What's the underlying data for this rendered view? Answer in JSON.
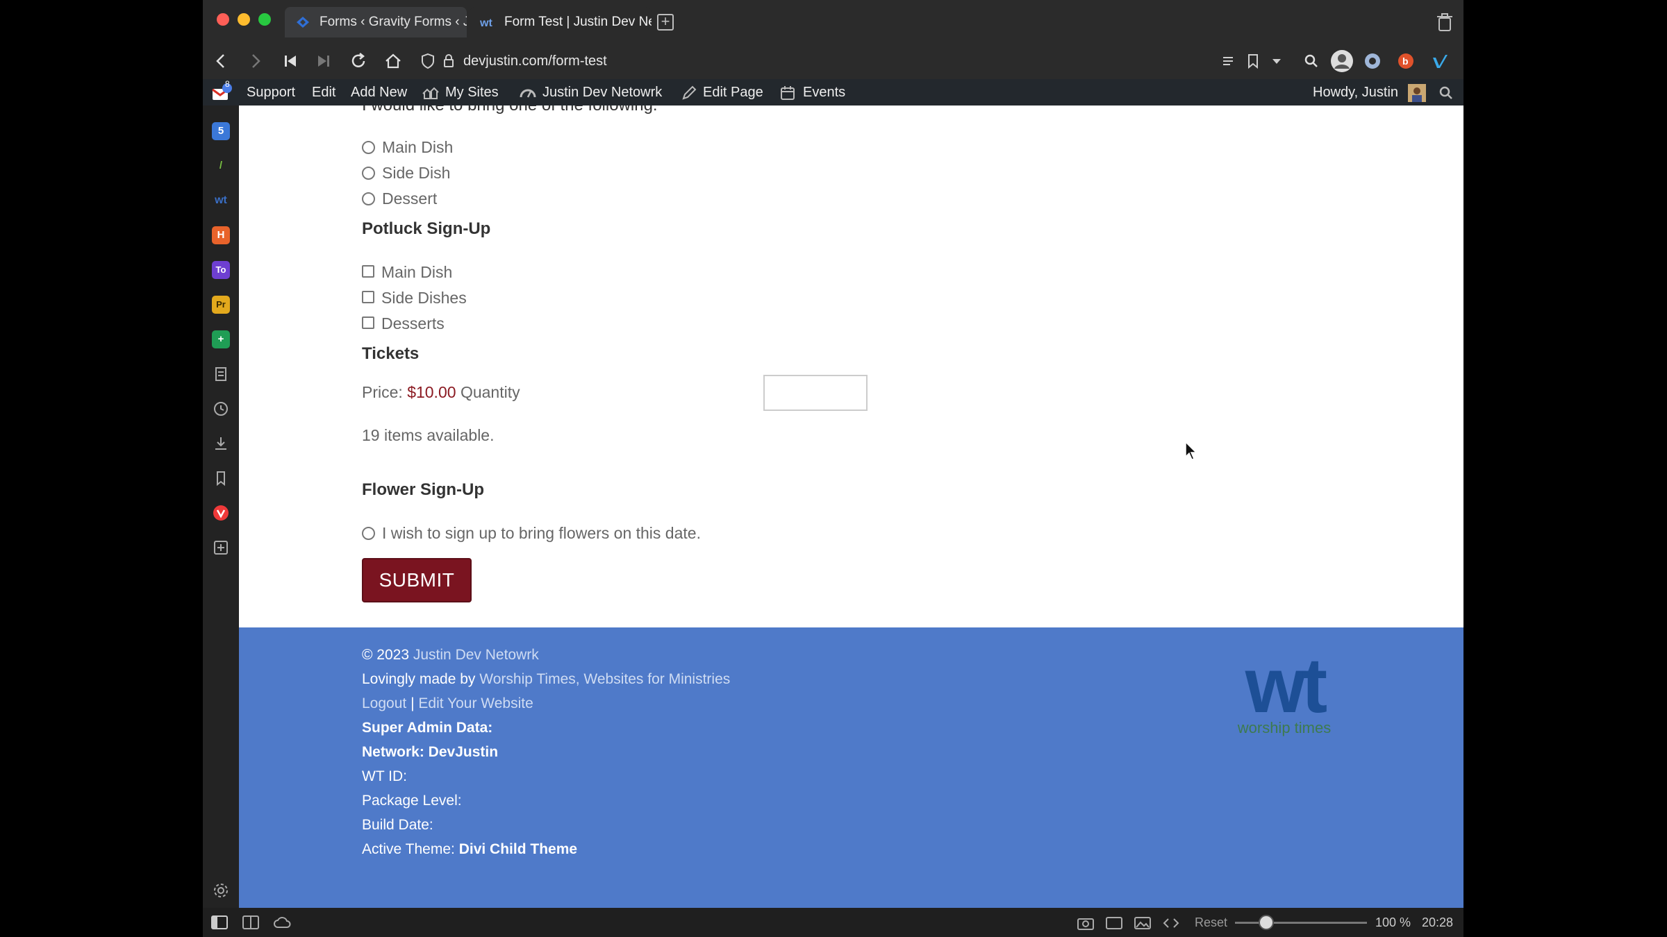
{
  "browser": {
    "tabs": [
      {
        "label": "Forms ‹ Gravity Forms ‹ Justin Dev Netowrk"
      },
      {
        "label": "Form Test | Justin Dev Netowrk"
      }
    ],
    "url": "devjustin.com/form-test"
  },
  "admin_bar": {
    "support": "Support",
    "edit": "Edit",
    "add_new": "Add New",
    "my_sites": "My Sites",
    "site_name": "Justin Dev Netowrk",
    "edit_page": "Edit Page",
    "events": "Events",
    "howdy": "Howdy, Justin",
    "notif_count": "8"
  },
  "form": {
    "bring_heading": "I would like to bring one of the following:",
    "bring_options": [
      "Main Dish",
      "Side Dish",
      "Dessert"
    ],
    "potluck_title": "Potluck Sign-Up",
    "potluck_options": [
      "Main Dish",
      "Side Dishes",
      "Desserts"
    ],
    "tickets_title": "Tickets",
    "price_label": "Price:",
    "price_value": "$10.00",
    "quantity_label": "Quantity",
    "quantity_value": "",
    "available": "19 items available.",
    "flower_title": "Flower Sign-Up",
    "flower_option": "I wish to sign up to bring flowers on this date.",
    "submit_label": "SUBMIT"
  },
  "footer": {
    "copyright": "© 2023",
    "site_link": "Justin Dev Netowrk",
    "made_by": "Lovingly made by",
    "made_by_link": "Worship Times, Websites for Ministries",
    "logout": "Logout",
    "separator": "|",
    "edit_website": "Edit Your Website",
    "super_admin": "Super Admin Data:",
    "network": "Network: DevJustin",
    "wt_id": "WT ID:",
    "package_level": "Package Level:",
    "build_date": "Build Date:",
    "active_theme_label": "Active Theme:",
    "active_theme_value": "Divi Child Theme",
    "logo_mark": "wt",
    "logo_text": "worship times"
  },
  "status_bar": {
    "reset": "Reset",
    "zoom": "100 %",
    "time": "20:28"
  },
  "colors": {
    "footer_bg": "#4f7ac9",
    "submit_bg": "#7a1420",
    "price": "#8b1a22",
    "admin_bar": "#23282d"
  }
}
